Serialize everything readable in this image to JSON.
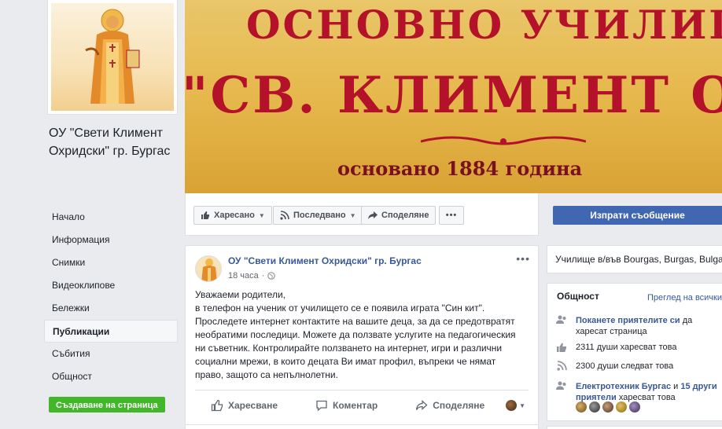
{
  "page": {
    "name": "ОУ \"Свети Климент Охридски\" гр. Бургас"
  },
  "cover": {
    "line1": "ОСНОВНО УЧИЛИЩЕ",
    "line2": "\"СВ. КЛИМЕНТ ОХРИДСКИ\"",
    "line3": "основано 1884 година"
  },
  "nav": {
    "items": [
      "Начало",
      "Информация",
      "Снимки",
      "Видеоклипове",
      "Бележки",
      "Публикации",
      "Събития",
      "Общност"
    ],
    "active": "Публикации",
    "create_label": "Създаване на страница"
  },
  "actions": {
    "like": "Харесано",
    "follow": "Последвано",
    "share": "Споделяне",
    "send_message": "Изпрати съобщение"
  },
  "post": {
    "author": "ОУ \"Свети Климент Охридски\" гр. Бургас",
    "time": "18 часа",
    "text_lines": [
      "Уважаеми родители,",
      "в телефон на ученик от училището се е появила играта \"Син кит\".",
      "Проследете интернет контактите на вашите деца, за да се предотвратят",
      "необратими последици. Можете да ползвате услугите на педагогическия",
      "ни съветник. Контролирайте ползването на интернет, игри и различни",
      "социални мрежи, в които децата Ви имат профил, въпреки че нямат",
      "право, защото са непълнолетни."
    ],
    "like_label": "Харесване",
    "comment_label": "Коментар",
    "share_label": "Споделяне"
  },
  "sidebar_right": {
    "info": "Училище в/във Bourgas, Burgas, Bulgaria",
    "community": {
      "title": "Общност",
      "see_all": "Преглед на всички",
      "invite_link": "Поканете приятелите си",
      "invite_rest": " да харесат страница",
      "likes": "2311 души харесват това",
      "follows": "2300 души следват това",
      "friends_link1": "Електротехник Бургас",
      "friends_and": " и ",
      "friends_link2": "15 други приятели",
      "friends_rest": " харесват това"
    }
  },
  "colors": {
    "brand_blue": "#4267b2",
    "link": "#385898",
    "cover_red": "#b3122a",
    "green": "#42b72a"
  }
}
